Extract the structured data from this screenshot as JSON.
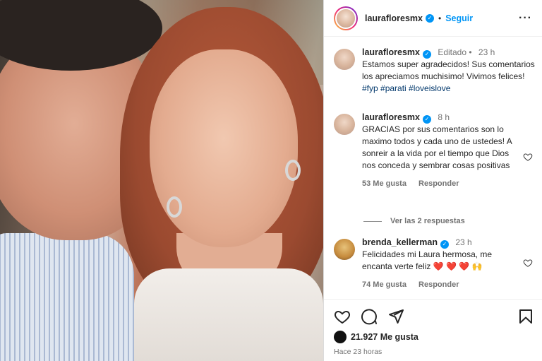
{
  "post": {
    "header": {
      "username": "laurafloresmx",
      "separator": "•",
      "follow_label": "Seguir",
      "more_label": "···"
    },
    "comments": [
      {
        "username": "laurafloresmx",
        "edited": "Editado",
        "separator": "•",
        "time": "23 h",
        "text_main": "Estamos super agradecidos! Sus comentarios los apreciamos muchisimo! Vivimos felices! ",
        "hashtags": "#fyp #parati #loveislove"
      },
      {
        "username": "laurafloresmx",
        "time": "8 h",
        "text": "GRACIAS por sus comentarios son lo maximo todos y cada uno de ustedes! A sonreir a la vida por el tiempo que Dios nos conceda y sembrar cosas positivas",
        "likes": "53 Me gusta",
        "reply": "Responder"
      },
      {
        "username": "brenda_kellerman",
        "time": "23 h",
        "text": "Felicidades mi Laura hermosa, me encanta verte feliz ",
        "emoji": "❤️ ❤️ ❤️ 🙌",
        "likes": "74 Me gusta",
        "reply": "Responder"
      }
    ],
    "view_replies": "Ver las 2 respuestas",
    "likes_count": "21.927 Me gusta",
    "timestamp": "Hace 23 horas",
    "icons": [
      "heart-icon",
      "comment-icon",
      "share-icon",
      "bookmark-icon"
    ],
    "colors": {
      "link": "#0095f6",
      "hashtag": "#00376b",
      "muted": "#737373",
      "verified": "#0095f6"
    }
  }
}
